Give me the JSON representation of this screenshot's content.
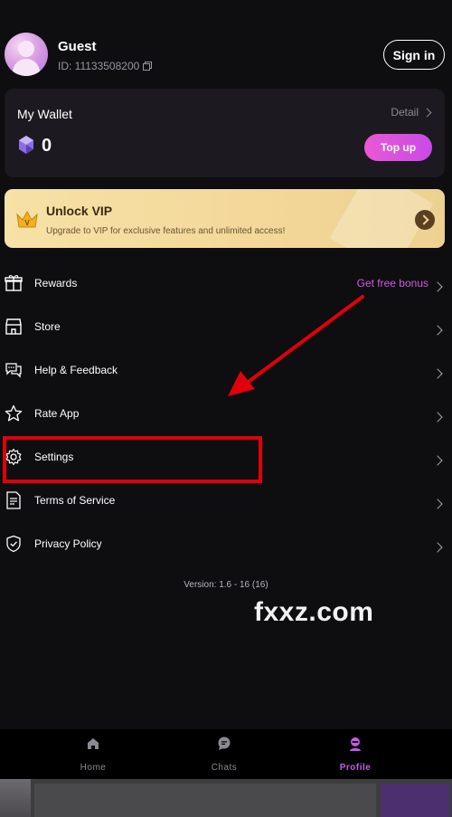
{
  "profile": {
    "name": "Guest",
    "id": "ID: 11133508200",
    "sign_in_label": "Sign in"
  },
  "wallet": {
    "title": "My Wallet",
    "detail_label": "Detail",
    "balance": "0",
    "top_up_label": "Top up"
  },
  "vip": {
    "title": "Unlock VIP",
    "subtitle": "Upgrade to VIP for exclusive features and unlimited access!"
  },
  "menu": {
    "items": [
      {
        "label": "Rewards",
        "extra": "Get free bonus",
        "icon": "gift-icon"
      },
      {
        "label": "Store",
        "icon": "store-icon"
      },
      {
        "label": "Help & Feedback",
        "icon": "chat-bubbles-icon"
      },
      {
        "label": "Rate App",
        "icon": "star-icon"
      },
      {
        "label": "Settings",
        "icon": "gear-icon"
      },
      {
        "label": "Terms of Service",
        "icon": "document-icon"
      },
      {
        "label": "Privacy Policy",
        "icon": "shield-icon"
      }
    ]
  },
  "version": "Version: 1.6 - 16 (16)",
  "watermark": "fxxz.com",
  "tabs": [
    {
      "label": "Home",
      "icon": "home-icon"
    },
    {
      "label": "Chats",
      "icon": "chat-icon"
    },
    {
      "label": "Profile",
      "icon": "profile-icon",
      "active": true
    }
  ],
  "colors": {
    "background": "#0e0d10",
    "accent": "#c84ae6",
    "annotation": "#e0000b"
  }
}
